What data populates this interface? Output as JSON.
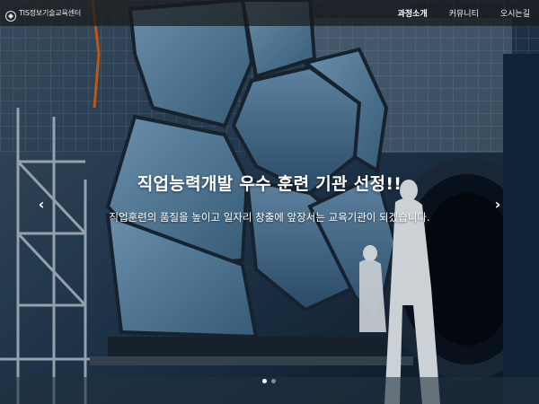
{
  "header": {
    "logo_text": "TIS정보기술교육센터",
    "nav": [
      {
        "label": "과정소개",
        "active": true
      },
      {
        "label": "커뮤니티",
        "active": false
      },
      {
        "label": "오시는길",
        "active": false
      }
    ]
  },
  "hero": {
    "headline": "직업능력개발 우수 훈련 기관 선정!!",
    "subline": "직업훈련의 품질을 높이고 일자리 창출에 앞장서는 교육기관이 되겠습니다.",
    "prev_arrow": "‹",
    "next_arrow": "›",
    "slides_total": 2,
    "slide_active": 1
  },
  "colors": {
    "topbar": "#191919",
    "mirror": "#5e89ab",
    "mirror_dark": "#2c4a66"
  },
  "icons": [
    "logo-icon",
    "chevron-left-icon",
    "chevron-right-icon"
  ]
}
